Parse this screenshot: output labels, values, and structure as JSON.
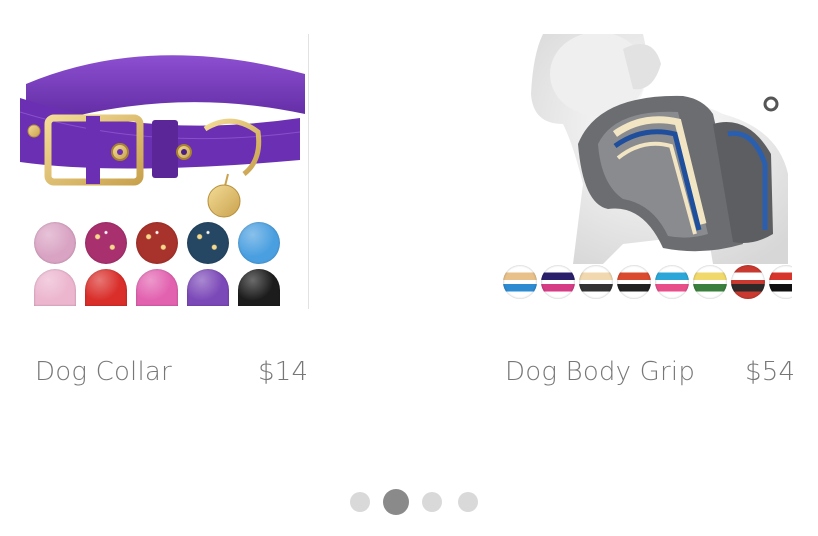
{
  "products": [
    {
      "name": "Dog Collar",
      "price": "$14",
      "color_options": [
        "#d9a3c3",
        "#a8306e",
        "#a8322c",
        "#254764",
        "#4a9fe0",
        "#ecb6cf",
        "#d92e2a",
        "#e262b0",
        "#7c49b8",
        "#1c1c1c"
      ]
    },
    {
      "name": "Dog Body Grip",
      "price": "$54",
      "pattern_options": [
        [
          "#e7c08a",
          "#ffffff",
          "#2d8bd1"
        ],
        [
          "#2a1f6b",
          "#ffffff",
          "#d63b86"
        ],
        [
          "#f1d8ae",
          "#ffffff",
          "#333333"
        ],
        [
          "#d94a2f",
          "#ffffff",
          "#222222"
        ],
        [
          "#2aa7d8",
          "#ffffff",
          "#e84f8a"
        ],
        [
          "#f0d86a",
          "#ffffff",
          "#3a7f3e"
        ],
        [
          "#ffffff",
          "#c9392f",
          "#2f2a2a"
        ],
        [
          "#d7342c",
          "#ffffff",
          "#111111"
        ]
      ]
    }
  ],
  "pager": {
    "total": 4,
    "active": 1
  },
  "colors": {
    "text": "#777777",
    "dot": "#d9d9d9",
    "dot_active": "#8a8a8a"
  }
}
